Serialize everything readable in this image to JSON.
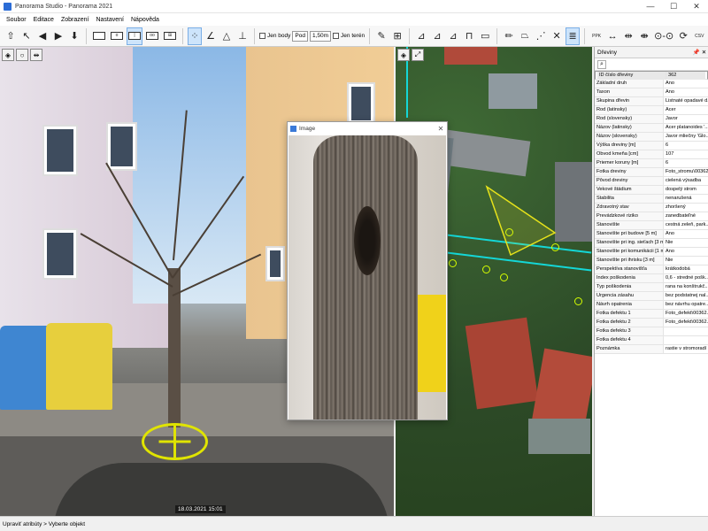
{
  "window": {
    "title": "Panorama Studio - Panorama 2021",
    "minimize": "—",
    "maximize": "☐",
    "close": "✕"
  },
  "menu": [
    "Soubor",
    "Editace",
    "Zobrazení",
    "Nastavení",
    "Nápověda"
  ],
  "toolbar": {
    "point_checkbox_label": "Jen body",
    "point_type_value": "Pod",
    "distance_value": "1,50m",
    "ground_checkbox_label": "Jen terén",
    "ppk_label": "PPK",
    "csv_label": "CSV"
  },
  "panorama": {
    "timestamp": "18.03.2021 15:01"
  },
  "image_popup": {
    "title": "Image",
    "close": "✕"
  },
  "attributes": {
    "title": "Dřeviny",
    "pin": "📌",
    "close": "✕",
    "rows": [
      {
        "key": "ID číslo dřeviny",
        "value": "362"
      },
      {
        "key": "Základní druh",
        "value": "Ano"
      },
      {
        "key": "Taxon",
        "value": "Ano"
      },
      {
        "key": "Skupina dřevin",
        "value": "Listnaté opadavé d..."
      },
      {
        "key": "Rod (latinsky)",
        "value": "Acer"
      },
      {
        "key": "Rod (slovensky)",
        "value": "Javor"
      },
      {
        "key": "Názov (latinsky)",
        "value": "Acer platanoides '..."
      },
      {
        "key": "Názov (slovensky)",
        "value": "Javor mliečny 'Glo..."
      },
      {
        "key": "Výška dreviny [m]",
        "value": "6"
      },
      {
        "key": "Obvod kmeňa [cm]",
        "value": "107"
      },
      {
        "key": "Priemer koruny [m]",
        "value": "6"
      },
      {
        "key": "Fotka dreviny",
        "value": "Foto_stromu\\00362..."
      },
      {
        "key": "Pôvod dreviny",
        "value": "cielená výsadba"
      },
      {
        "key": "Vekové štádium",
        "value": "dospelý strom"
      },
      {
        "key": "Stabilita",
        "value": "nenarušená"
      },
      {
        "key": "Zdravotný stav",
        "value": "zhoršený"
      },
      {
        "key": "Prevádzkové riziko",
        "value": "zanedbateľné"
      },
      {
        "key": "Stanovište",
        "value": "cestná zeleň, park..."
      },
      {
        "key": "Stanovište pri budove [5 m]",
        "value": "Ano"
      },
      {
        "key": "Stanovište pri ing. sieťach [3 m]",
        "value": "Nie"
      },
      {
        "key": "Stanovište pri komunikácii [1 m]",
        "value": "Ano"
      },
      {
        "key": "Stanovište pri ihrisku [3 m]",
        "value": "Nie"
      },
      {
        "key": "Perspektíva stanovišťa",
        "value": "krátkodobá"
      },
      {
        "key": "Index poškodenia",
        "value": "0,6 - stredné pošk..."
      },
      {
        "key": "Typ poškodenia",
        "value": "rana na konštrukč..."
      },
      {
        "key": "Urgencia zásahu",
        "value": "bez podstatnej nal..."
      },
      {
        "key": "Návrh opatrenia",
        "value": "bez návrhu opatre..."
      },
      {
        "key": "Fotka defektu 1",
        "value": "Foto_defekt\\00362..."
      },
      {
        "key": "Fotka defektu 2",
        "value": "Foto_defekt\\00362..."
      },
      {
        "key": "Fotka defektu 3",
        "value": ""
      },
      {
        "key": "Fotka defektu 4",
        "value": ""
      },
      {
        "key": "Poznámka",
        "value": "rastie v stromoradí"
      }
    ]
  },
  "status": {
    "text": "Upraviť atribúty > Vyberte objekt"
  },
  "colors": {
    "accent": "#2b6cd6",
    "marker": "#e0e400",
    "map_line": "#14d7d7",
    "map_tree": "#d6ff00"
  }
}
